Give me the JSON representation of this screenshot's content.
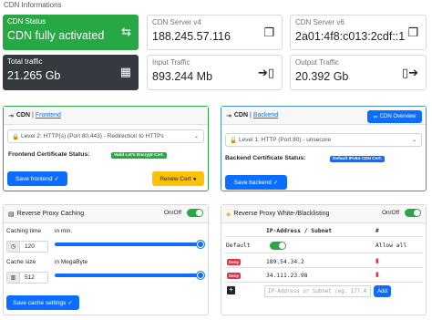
{
  "heading": "CDN Informations",
  "tiles": {
    "cdn_status": {
      "label": "CDN Status",
      "value": "CDN fully activated",
      "icon": "exchange-arrows-icon"
    },
    "server_v4": {
      "label": "CDN Server v4",
      "value": "188.245.57.116",
      "icon": "copy-icon"
    },
    "server_v6": {
      "label": "CDN Server v6",
      "value": "2a01:4f8:c013:2cdf::1",
      "icon": "copy-icon"
    },
    "total_traffic": {
      "label": "Total traffic",
      "value": "21.265 Gb",
      "icon": "cash-register-icon"
    },
    "input_traffic": {
      "label": "Input Traffic",
      "value": "893.244 Mb",
      "icon": "sign-in-icon"
    },
    "output_traffic": {
      "label": "Output Traffic",
      "value": "20.392 Gb",
      "icon": "sign-out-icon"
    }
  },
  "frontend": {
    "title_bold": "CDN",
    "title_sep": "|",
    "title_link": "Frontend",
    "select_value": "Level 2: HTTP(s) (Port 80,443) - Redirection to HTTPs",
    "cert_label": "Frontend Certificate Status:",
    "cert_badge": "Valid Let's Encrypt Cert.",
    "save_button": "Save frontend",
    "renew_button": "Renew Cert"
  },
  "backend": {
    "title_bold": "CDN",
    "title_sep": "|",
    "title_link": "Backend",
    "overview_button": "CDN Overview",
    "select_value": "Level 1: HTTP (Port 80) - unsecure",
    "cert_label": "Backend Certificate Status:",
    "cert_badge": "Default IPv64 CDN Cert.",
    "save_button": "Save backend"
  },
  "caching": {
    "title": "Reverse Proxy Caching",
    "onoff_label": "On/Off",
    "caching_time_label": "Caching time",
    "caching_time_unit": "in min.",
    "caching_time_value": "120",
    "cache_size_label": "Cache size",
    "cache_size_unit": "in MegaByte",
    "cache_size_value": "512",
    "save_button": "Save cache settings"
  },
  "whitelist": {
    "title": "Reverse Proxy White-/Blacklisting",
    "onoff_label": "On/Off",
    "col_address": "IP-Address / Subnet",
    "col_hash": "#",
    "default_label": "Default",
    "default_action": "Allow all",
    "rows": [
      {
        "badge": "Deny",
        "address": "189.54.34.2"
      },
      {
        "badge": "Deny",
        "address": "34.111.23.98"
      }
    ],
    "input_placeholder": "IP-Address or Subnet (eg. 177.4",
    "add_button": "Add"
  },
  "colors": {
    "green": "#28a745",
    "dark": "#343a40",
    "blue": "#0d6efd",
    "warning": "#ffc107",
    "danger": "#dc3545"
  }
}
